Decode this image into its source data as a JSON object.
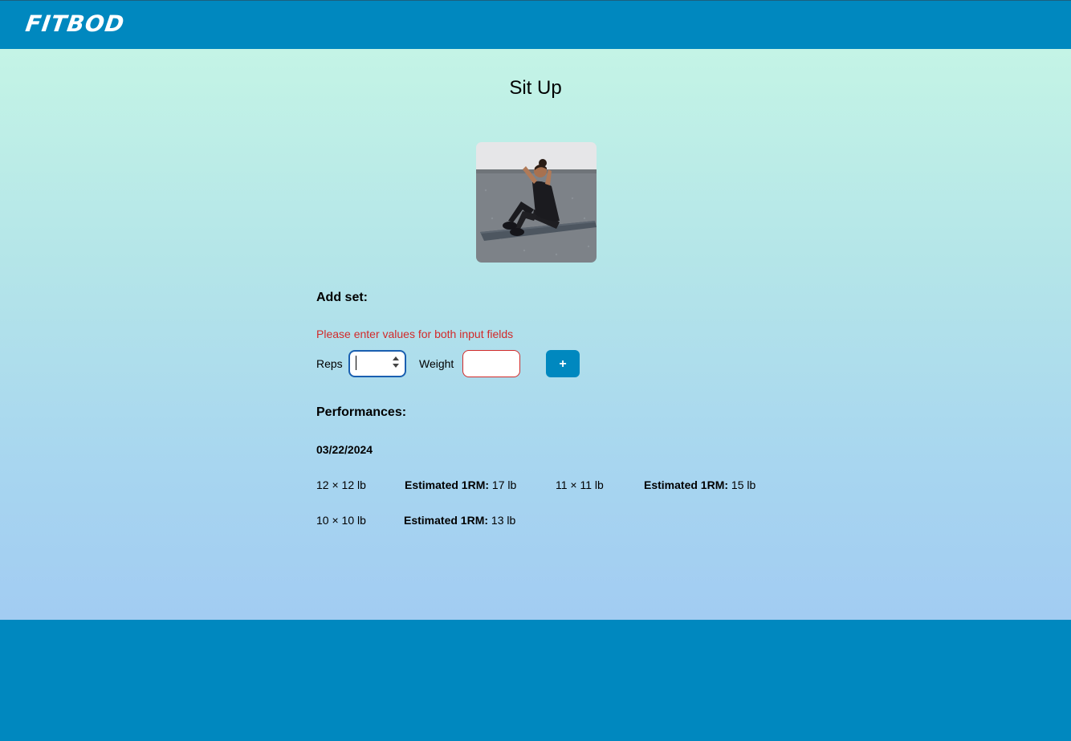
{
  "header": {
    "logo_text": "FITBOD"
  },
  "exercise": {
    "title": "Sit Up",
    "image_alt": "Woman doing sit up on exercise mat"
  },
  "add_set": {
    "label": "Add set:",
    "error_message": "Please enter values for both input fields",
    "reps_label": "Reps",
    "reps_value": "",
    "weight_label": "Weight",
    "weight_value": "",
    "add_button_label": "+"
  },
  "performances": {
    "label": "Performances:",
    "sessions": [
      {
        "date": "03/22/2024",
        "sets": [
          {
            "set": "12 × 12 lb",
            "erm_label": "Estimated 1RM:",
            "erm_value": " 17 lb"
          },
          {
            "set": "11 × 11 lb",
            "erm_label": "Estimated 1RM:",
            "erm_value": " 15 lb"
          },
          {
            "set": "10 × 10 lb",
            "erm_label": "Estimated 1RM:",
            "erm_value": " 13 lb"
          }
        ]
      }
    ]
  },
  "colors": {
    "brand_blue": "#0088bf",
    "error_red": "#d22a2a",
    "gradient_top": "#c4f4e6",
    "gradient_bottom": "#a2ccf2"
  }
}
